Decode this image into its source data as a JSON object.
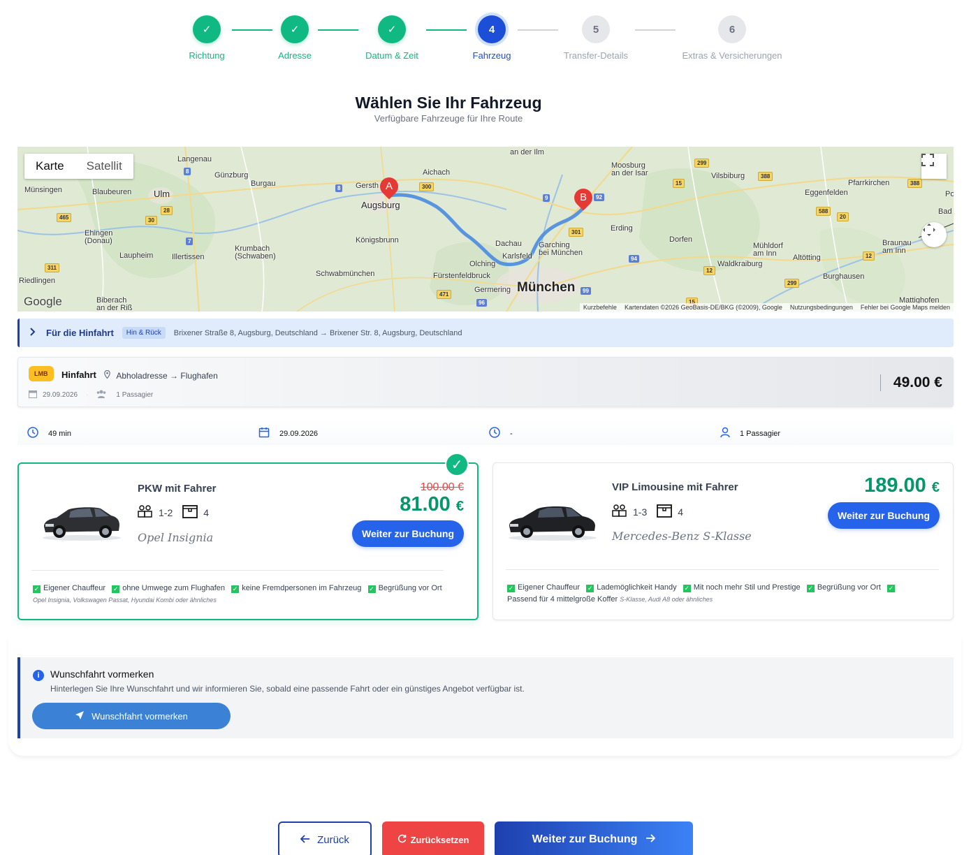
{
  "stepper": {
    "steps": [
      {
        "number": "1",
        "label": "Richtung",
        "state": "done"
      },
      {
        "number": "2",
        "label": "Adresse",
        "state": "done"
      },
      {
        "number": "3",
        "label": "Datum & Zeit",
        "state": "done"
      },
      {
        "number": "4",
        "label": "Fahrzeug",
        "state": "active"
      },
      {
        "number": "5",
        "label": "Transfer-Details",
        "state": "todo"
      },
      {
        "number": "6",
        "label": "Extras & Versicherungen",
        "state": "todo"
      }
    ],
    "done_symbol": "✓",
    "done_color": "#10b981",
    "active_color": "#1d4ed8"
  },
  "header": {
    "title": "Wählen Sie Ihr Fahrzeug",
    "subtitle": "Verfügbare Fahrzeuge für Ihre Route"
  },
  "map": {
    "type_control": {
      "map": "Karte",
      "satellite": "Satellit"
    },
    "fullscreen_icon": "fullscreen-icon",
    "camera_icon": "camera-control-icon",
    "marker_a": "A",
    "marker_b": "B",
    "places": {
      "langenau": "Langenau",
      "guenzburg": "Günzburg",
      "burgau": "Burgau",
      "gersthofen": "Gersth",
      "augsburg": "Augsburg",
      "aichach": "Aichach",
      "an_der_ilm": "an der Ilm",
      "moosburg": "Moosburg\nan der Isar",
      "vilsbiburg": "Vilsbiburg",
      "pfarrkirchen": "Pfarrkirchen",
      "eggenfelden": "Eggenfelden",
      "muensingen": "Münsingen",
      "blaubeuren": "Blaubeuren",
      "ulm": "Ulm",
      "ehingen": "Ehingen\n(Donau)",
      "laupheim": "Laupheim",
      "illertissen": "Illertissen",
      "krumbach": "Krumbach\n(Schwaben)",
      "koenigsbrunn": "Königsbrunn",
      "schwabmuenchen": "Schwabmünchen",
      "dachau": "Dachau",
      "karlsfeld": "Karlsfeld",
      "olching": "Olching",
      "garching": "Garching\nbei München",
      "fuerstenfeldbruck": "Fürstenfeldbruck",
      "germering": "Germering",
      "muenchen": "München",
      "erding": "Erding",
      "dorfen": "Dorfen",
      "muehldorf": "Mühldorf\nam Inn",
      "waldkraiburg": "Waldkraiburg",
      "altoetting": "Altötting",
      "burghausen": "Burghausen",
      "braunau": "Braunau\nam Inn",
      "riedlingen": "Riedlingen",
      "biberach": "Biberach\nan der Riß",
      "mattighofen": "Mattighofen",
      "bad": "Bad",
      "po": "Po"
    },
    "roads": {
      "r8a": "8",
      "r8b": "8",
      "r300": "300",
      "r9": "9",
      "r92": "92",
      "r7": "7",
      "r28": "28",
      "r30": "30",
      "r465": "465",
      "r311": "311",
      "r301": "301",
      "r94": "94",
      "r99": "99",
      "r96": "96",
      "r471": "471",
      "r299a": "299",
      "r15": "15",
      "r388a": "388",
      "r388b": "388",
      "r588": "588",
      "r20": "20",
      "r12a": "12",
      "r12b": "12",
      "r299b": "299",
      "r15b": "15"
    },
    "google_logo": "Google",
    "attribution": [
      "Kurzbefehle",
      "Kartendaten ©2026 GeoBasis-DE/BKG (©2009), Google",
      "Nutzungsbedingungen",
      "Fehler bei Google Maps melden"
    ]
  },
  "route_bar": {
    "chevron_icon": "chevron-right-icon",
    "title": "Für die Hinfahrt",
    "badge": "Hin & Rück",
    "addresses": "Brixener Straße 8, Augsburg, Deutschland → Brixener Str. 8, Augsburg, Deutschland"
  },
  "trip": {
    "badge": "LMB",
    "title": "Hinfahrt",
    "route": "Abholadresse → Flughafen",
    "date": "29.09.2026",
    "passengers": "1 Passagier",
    "separator": "·",
    "price": "49.00 €"
  },
  "info_row": {
    "duration": "49 min",
    "date": "29.09.2026",
    "time": "-",
    "passengers": "1 Passagier"
  },
  "vehicles": [
    {
      "name": "PKW mit Fahrer",
      "passengers": "1-2",
      "luggage": "4",
      "model": "Opel Insignia",
      "old_price": "100.00 €",
      "price": "81.00",
      "currency": "€",
      "button": "Weiter zur Buchung",
      "selected": true,
      "features": [
        "Eigener Chauffeur",
        "ohne Umwege zum Flughafen",
        "keine Fremdpersonen im Fahrzeug",
        "Begrüßung vor Ort"
      ],
      "alternatives": "Opel Insignia, Volkswagen Passat, Hyundai Kombi oder ähnliches"
    },
    {
      "name": "VIP Limousine mit Fahrer",
      "passengers": "1-3",
      "luggage": "4",
      "model": "Mercedes-Benz S-Klasse",
      "price": "189.00",
      "currency": "€",
      "button": "Weiter zur Buchung",
      "selected": false,
      "features": [
        "Eigener Chauffeur",
        "Lademöglichkeit Handy",
        "Mit noch mehr Stil und Prestige",
        "Begrüßung vor Ort",
        "Passend für 4 mittelgroße Koffer"
      ],
      "alternatives": "S-Klasse, Audi A8  oder ähnliches"
    }
  ],
  "wish": {
    "title": "Wunschfahrt vormerken",
    "text": "Hinterlegen Sie Ihre Wunschfahrt und wir informieren Sie, sobald eine passende Fahrt oder ein günstiges Angebot verfügbar ist.",
    "button": "Wunschfahrt vormerken"
  },
  "nav": {
    "back": "Zurück",
    "reset": "Zurücksetzen",
    "next": "Weiter zur Buchung"
  }
}
